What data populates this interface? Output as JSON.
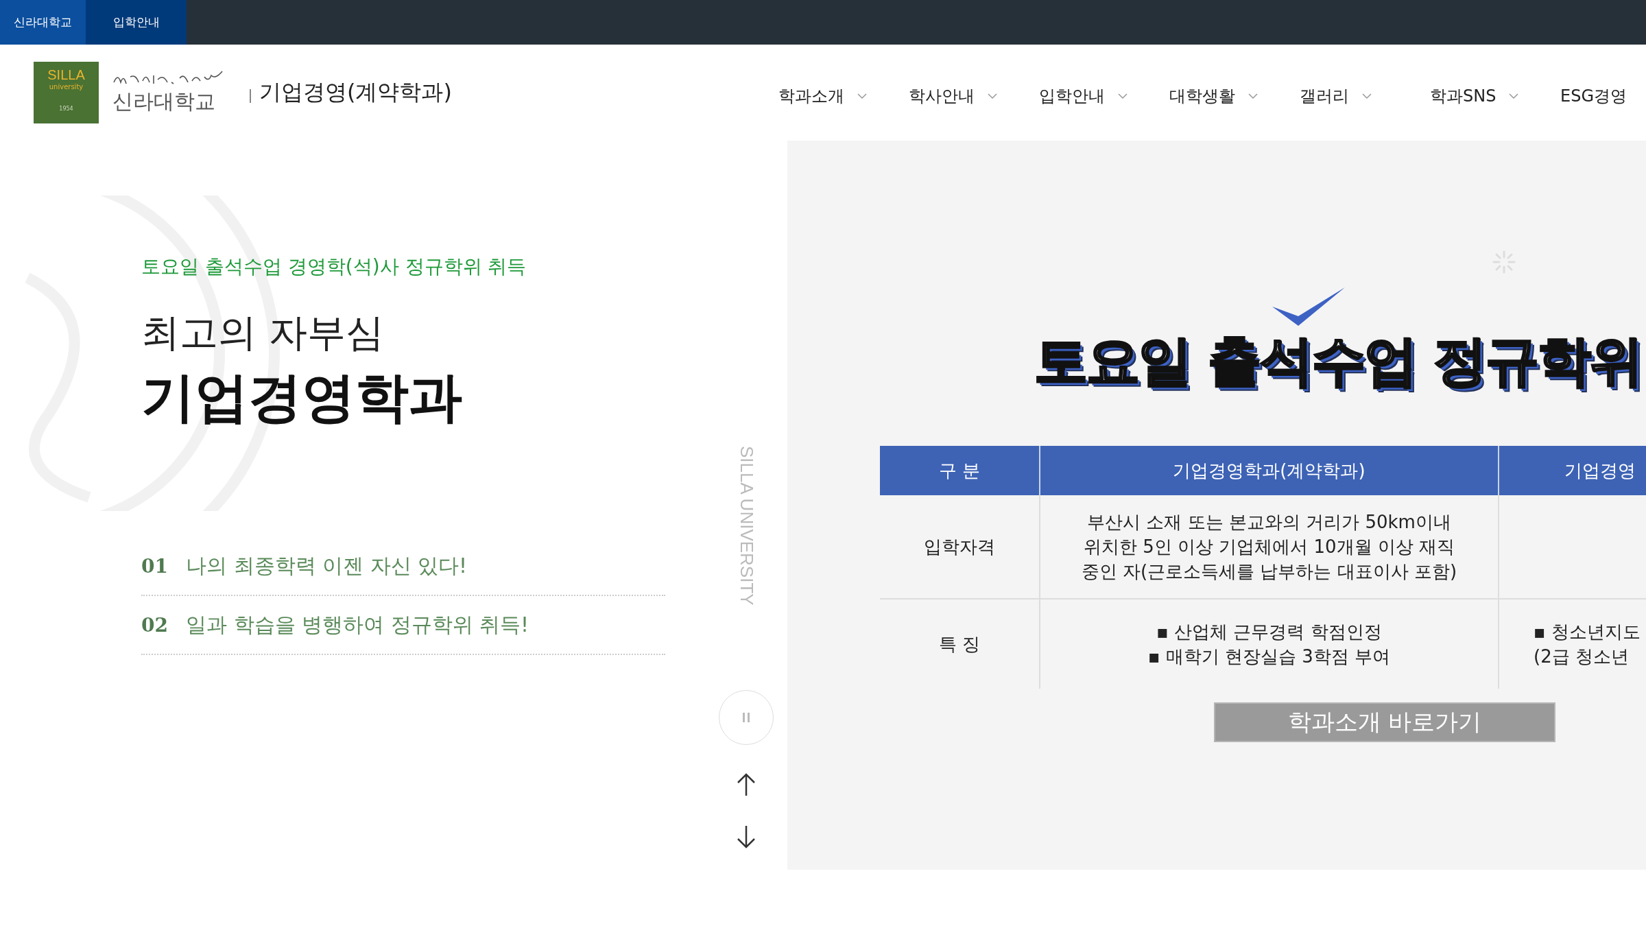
{
  "top_bar": {
    "links": [
      {
        "label": "신라대학교",
        "selected": true
      },
      {
        "label": "입학안내",
        "selected": false
      }
    ]
  },
  "header": {
    "logo": {
      "badge_title": "SILLA",
      "badge_sub": "university",
      "badge_year": "1954",
      "name": "신라대학교"
    },
    "department": "기업경영(계약학과)",
    "nav": [
      {
        "label": "학과소개",
        "has_menu": true
      },
      {
        "label": "학사안내",
        "has_menu": true
      },
      {
        "label": "입학안내",
        "has_menu": true
      },
      {
        "label": "대학생활",
        "has_menu": true
      },
      {
        "label": "갤러리",
        "has_menu": true
      },
      {
        "label": "학과SNS",
        "has_menu": true
      },
      {
        "label": "ESG경영",
        "has_menu": false
      }
    ]
  },
  "hero": {
    "subtitle": "토요일 출석수업 경영학(석)사 정규학위 취득",
    "title_light": "최고의 자부심",
    "title_bold": "기업경영학과",
    "points": [
      {
        "number": "01",
        "text": "나의 최종학력 이젠 자신 있다!"
      },
      {
        "number": "02",
        "text": "일과 학습을 병행하여 정규학위 취득!"
      }
    ],
    "side_label": "SILLA UNIVERSITY"
  },
  "slider": {
    "paused": false
  },
  "banner": {
    "headline": "토요일 출석수업 정규학위",
    "table": {
      "columns": [
        "구 분",
        "기업경영학과(계약학과)",
        "기업경영"
      ],
      "rows": [
        {
          "cells": [
            [
              "입학자격"
            ],
            [
              "부산시 소재 또는 본교와의 거리가 50km이내",
              "위치한 5인 이상 기업체에서 10개월 이상 재직",
              "중인 자(근로소득세를 납부하는 대표이사 포함)"
            ],
            []
          ]
        },
        {
          "cells": [
            [
              "특 징"
            ],
            [
              "▪ 산업체 근무경력 학점인정",
              "▪ 매학기 현장실습 3학점 부여"
            ],
            [
              "▪ 청소년지도",
              "(2급 청소년"
            ]
          ]
        }
      ]
    },
    "button": "학과소개 바로가기"
  }
}
